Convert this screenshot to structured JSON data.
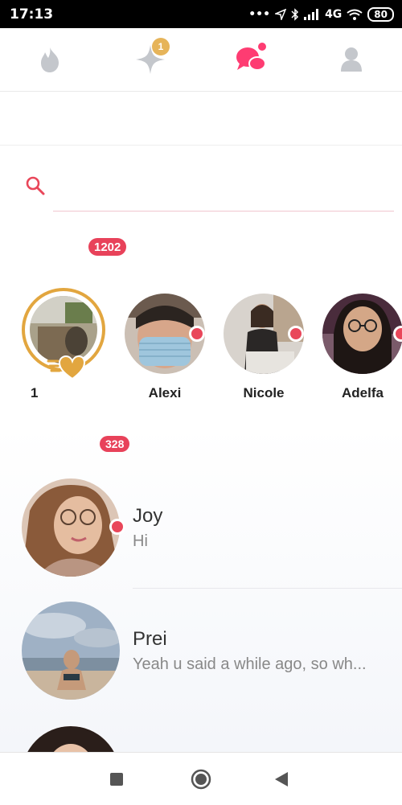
{
  "status_bar": {
    "time": "17:13",
    "network": "4G",
    "battery": "80",
    "icons": [
      "more-dots-icon",
      "location-arrow-icon",
      "bluetooth-icon",
      "signal-icon",
      "wifi-icon",
      "battery-icon"
    ]
  },
  "nav": {
    "tabs": [
      {
        "name": "flame-icon",
        "active": false
      },
      {
        "name": "sparkle-icon",
        "active": false,
        "badge": "1"
      },
      {
        "name": "chat-icon",
        "active": true,
        "dot": true
      },
      {
        "name": "profile-icon",
        "active": false
      }
    ],
    "accent_color": "#fe3c72",
    "badge_color": "#e6b45a"
  },
  "search": {
    "placeholder": "",
    "value": ""
  },
  "matches": {
    "count_badge": "1202",
    "likes_card": {
      "count": "1"
    },
    "items": [
      {
        "name": "Alexi",
        "online": true
      },
      {
        "name": "Nicole",
        "online": true
      },
      {
        "name": "Adelfa",
        "online": true
      }
    ]
  },
  "messages": {
    "count_badge": "328",
    "items": [
      {
        "name": "Joy",
        "preview": "Hi",
        "online": true
      },
      {
        "name": "Prei",
        "preview": "Yeah u said a while ago, so wh...",
        "online": false
      }
    ]
  },
  "colors": {
    "badge_red": "#e8425a",
    "likes_gold": "#e2a63f",
    "online_dot": "#e9475a"
  }
}
